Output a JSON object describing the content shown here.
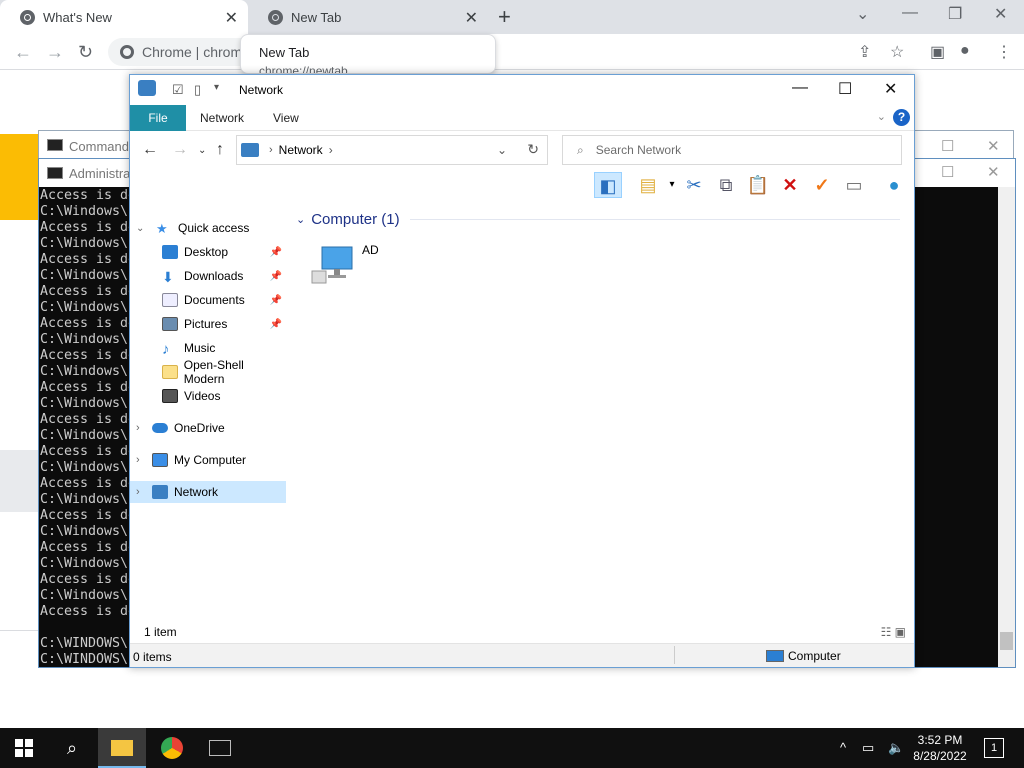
{
  "chrome": {
    "tabs": [
      {
        "title": "What's New",
        "active": true
      },
      {
        "title": "New Tab",
        "active": false
      }
    ],
    "omnibox_label": "Chrome | chrome",
    "tooltip": {
      "title": "New Tab",
      "url": "chrome://newtab"
    }
  },
  "cmd_back": {
    "title": "Command"
  },
  "cmd_front": {
    "title": "Administrat",
    "lines": [
      "Access is de",
      "C:\\Windows\\",
      "Access is de",
      "C:\\Windows\\",
      "Access is de",
      "C:\\Windows\\",
      "Access is de",
      "C:\\Windows\\",
      "Access is de",
      "C:\\Windows\\",
      "Access is de",
      "C:\\Windows\\",
      "Access is de",
      "C:\\Windows\\",
      "Access is de",
      "C:\\Windows\\",
      "Access is de",
      "C:\\Windows\\",
      "Access is de",
      "C:\\Windows\\",
      "Access is de",
      "C:\\Windows\\",
      "Access is de",
      "C:\\Windows\\",
      "Access is de",
      "C:\\Windows\\",
      "Access is de",
      "",
      "C:\\WINDOWS\\",
      "C:\\WINDOWS\\"
    ]
  },
  "explorer": {
    "title": "Network",
    "ribbon": {
      "file": "File",
      "tabs": [
        "Network",
        "View"
      ]
    },
    "address": {
      "segment": "Network"
    },
    "search_placeholder": "Search Network",
    "nav": {
      "quick_access": "Quick access",
      "items": [
        {
          "label": "Desktop",
          "icon": "desktop-icon",
          "pinned": true
        },
        {
          "label": "Downloads",
          "icon": "downloads-icon",
          "pinned": true
        },
        {
          "label": "Documents",
          "icon": "documents-icon",
          "pinned": true
        },
        {
          "label": "Pictures",
          "icon": "pictures-icon",
          "pinned": true
        },
        {
          "label": "Music",
          "icon": "music-icon",
          "pinned": false
        },
        {
          "label": "Open-Shell Modern",
          "icon": "folder-icon",
          "pinned": false
        },
        {
          "label": "Videos",
          "icon": "videos-icon",
          "pinned": false
        }
      ],
      "onedrive": "OneDrive",
      "my_computer": "My Computer",
      "network": "Network"
    },
    "group": {
      "title": "Computer (1)"
    },
    "items": [
      {
        "name": "AD",
        "icon": "computer-icon"
      }
    ],
    "status": {
      "count": "1 item",
      "selected": "0 items",
      "zone": "Computer"
    }
  },
  "taskbar": {
    "time": "3:52 PM",
    "date": "8/28/2022",
    "notifications": "1"
  }
}
